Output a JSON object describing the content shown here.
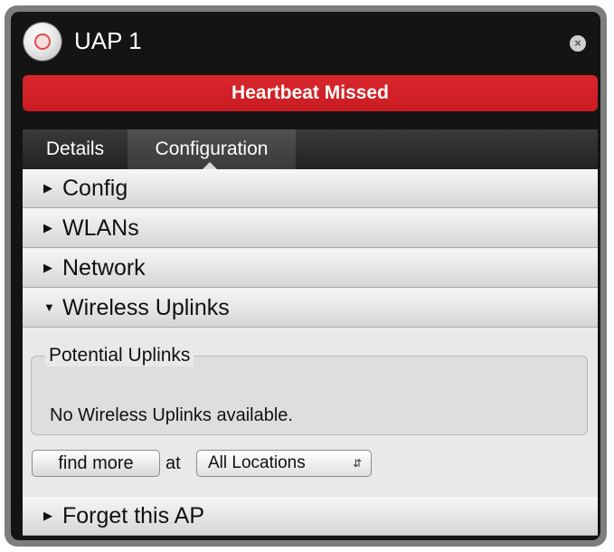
{
  "window": {
    "title": "UAP 1",
    "status_icon": "device-status-icon",
    "close_icon": "close-icon"
  },
  "alert": {
    "text": "Heartbeat Missed",
    "color": "#d02329"
  },
  "tabs": [
    {
      "label": "Details",
      "active": false
    },
    {
      "label": "Configuration",
      "active": true
    }
  ],
  "sections": [
    {
      "label": "Config",
      "expanded": false,
      "icon": "chevron-right-icon"
    },
    {
      "label": "WLANs",
      "expanded": false,
      "icon": "chevron-right-icon"
    },
    {
      "label": "Network",
      "expanded": false,
      "icon": "chevron-right-icon"
    },
    {
      "label": "Wireless Uplinks",
      "expanded": true,
      "icon": "chevron-down-icon"
    },
    {
      "label": "Forget this AP",
      "expanded": false,
      "icon": "chevron-right-icon"
    }
  ],
  "wireless_uplinks": {
    "legend": "Potential Uplinks",
    "empty_message": "No Wireless Uplinks available.",
    "find_more_label": "find more",
    "at_label": "at",
    "location_selected": "All Locations"
  }
}
